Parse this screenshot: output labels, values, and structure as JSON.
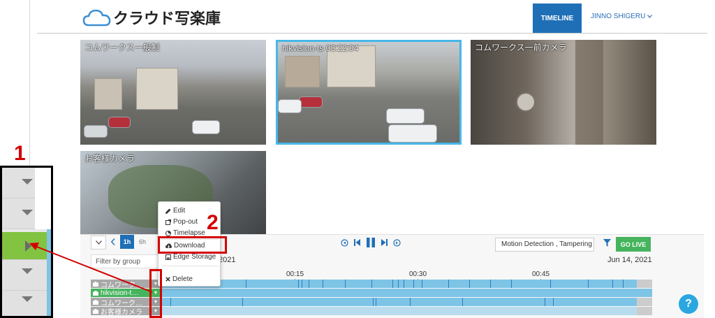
{
  "header": {
    "logo_text": "クラウド写楽庫",
    "nav_timeline": "TIMELINE",
    "user_name": "JINNO SHIGERU"
  },
  "cameras": [
    {
      "label": "コムワークス一般制"
    },
    {
      "label": "hikvision-ts 03:22:04"
    },
    {
      "label": "コムワークス一前カメラ"
    },
    {
      "label": "お客様カメラ"
    }
  ],
  "context_menu": {
    "items": [
      "Edit",
      "Pop-out",
      "Timelapse",
      "Download",
      "Edge Storage",
      "Delete"
    ]
  },
  "timeline": {
    "zoom_1h": "1h",
    "zoom_6h": "6h",
    "filter_placeholder": "Filter by group",
    "date_left": "2021",
    "date_right": "Jun 14, 2021",
    "ticks": [
      "00:15",
      "00:30",
      "00:45"
    ],
    "motion_filter": "Motion Detection , Tampering",
    "go_live": "GO LIVE",
    "rows": [
      "コムワーク…",
      "hikvision-t…",
      "コムワーク…",
      "お客様カメラ"
    ]
  },
  "annotations": {
    "step1": "1",
    "step2": "2"
  },
  "help": "?",
  "colors": {
    "brand_blue": "#1f6fb7",
    "go_live_green": "#46b35d",
    "timeline_blue": "#7ec4e6",
    "annotation_red": "#d40000"
  }
}
